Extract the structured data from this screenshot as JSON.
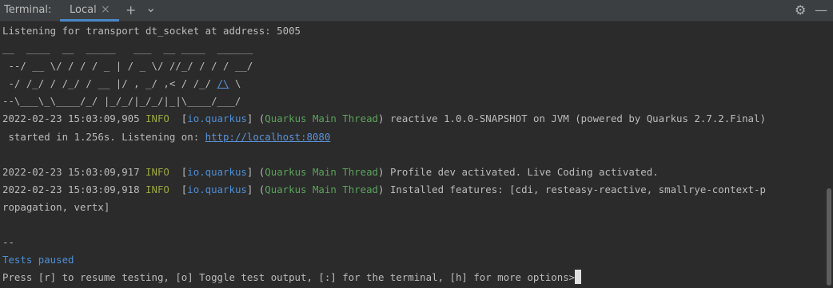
{
  "toolbar": {
    "title": "Terminal:",
    "tab_label": "Local",
    "tab_close": "×",
    "add_icon": "+",
    "dropdown_icon": "⌄",
    "settings_icon": "⚙",
    "minimize_icon": "—"
  },
  "terminal": {
    "line1": "Listening for transport dt_socket at address: 5005",
    "banner": [
      "__  ____  __  _____   ___  __ ____  ______ ",
      " --/ __ \\/ / / / _ | / _ \\/ //_/ / / / __/ ",
      " -/ /_/ / /_/ / __ |/ , _/ ,< / /_/ /\\ \\   ",
      "--\\___\\_\\____/_/ |_/_/|_/_/|_|\\____/___/   "
    ],
    "banner_link": "/\\",
    "log1": {
      "timestamp": "2022-02-23 15:03:09,905",
      "level": "INFO",
      "logger": "io.quarkus",
      "thread": "Quarkus Main Thread",
      "message": "reactive 1.0.0-SNAPSHOT on JVM (powered by Quarkus 2.7.2.Final)",
      "message2_prefix": " started in 1.256s. Listening on: ",
      "url": "http://localhost:8080"
    },
    "log2": {
      "timestamp": "2022-02-23 15:03:09,917",
      "level": "INFO",
      "logger": "io.quarkus",
      "thread": "Quarkus Main Thread",
      "message": "Profile dev activated. Live Coding activated."
    },
    "log3": {
      "timestamp": "2022-02-23 15:03:09,918",
      "level": "INFO",
      "logger": "io.quarkus",
      "thread": "Quarkus Main Thread",
      "message": "Installed features: [cdi, resteasy-reactive, smallrye-context-p",
      "message_cont": "ropagation, vertx]"
    },
    "separator": "--",
    "tests_paused": "Tests paused",
    "prompt": "Press [r] to resume testing, [o] Toggle test output, [:] for the terminal, [h] for more options>"
  },
  "colors": {
    "background": "#2b2b2b",
    "toolbar": "#3c3f41",
    "info": "#9aa73e",
    "logger": "#4e8fd5",
    "thread": "#5ba35b",
    "link": "#5a93d8"
  }
}
